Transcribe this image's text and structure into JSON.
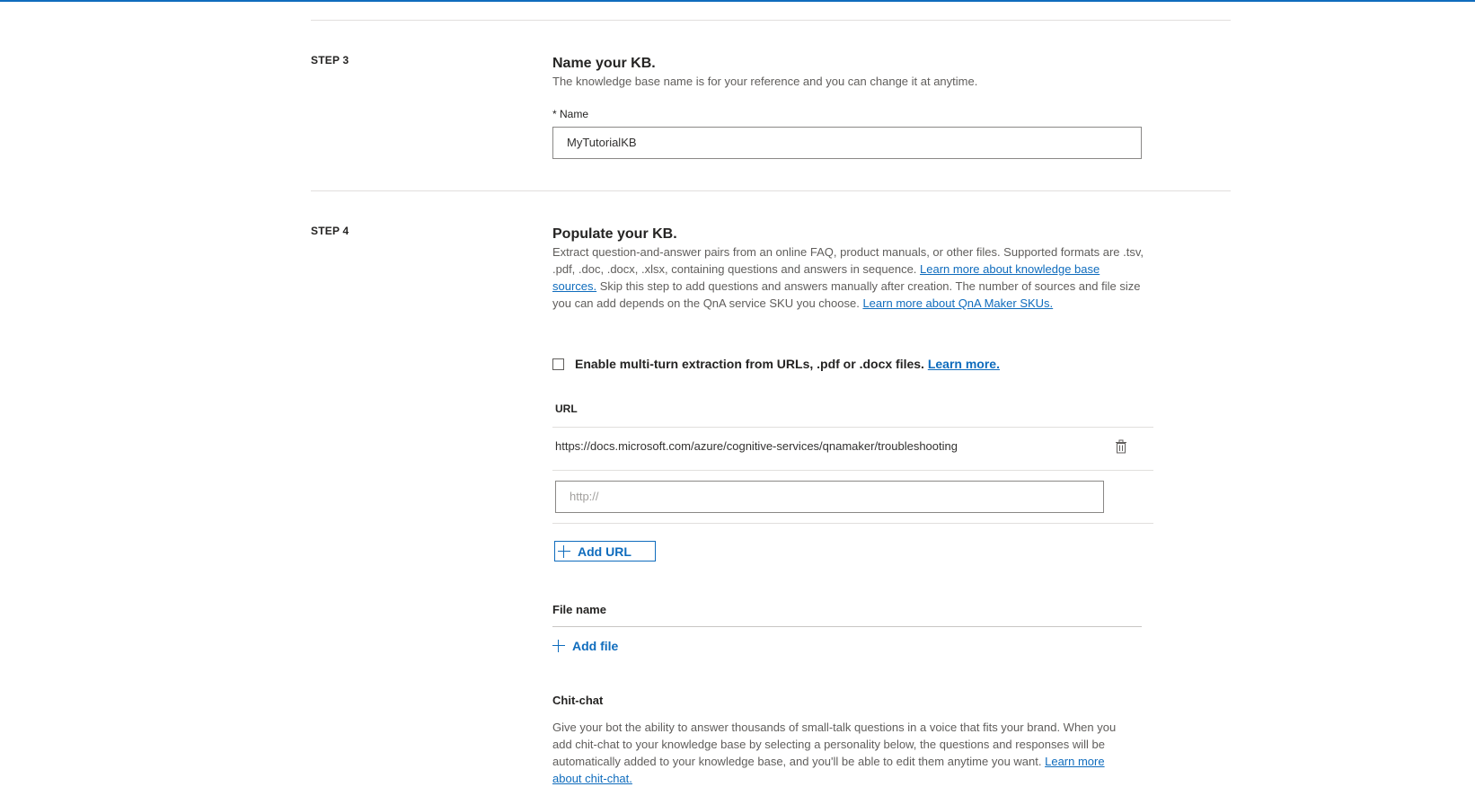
{
  "step3": {
    "label": "STEP 3",
    "title": "Name your KB.",
    "description": "The knowledge base name is for your reference and you can change it at anytime.",
    "name_label": "* Name",
    "name_value": "MyTutorialKB"
  },
  "step4": {
    "label": "STEP 4",
    "title": "Populate your KB.",
    "description_part1": "Extract question-and-answer pairs from an online FAQ, product manuals, or other files. Supported formats are .tsv, .pdf, .doc, .docx, .xlsx, containing questions and answers in sequence. ",
    "link_sources": "Learn more about knowledge base sources.",
    "description_part2": " Skip this step to add questions and answers manually after creation. The number of sources and file size you can add depends on the QnA service SKU you choose. ",
    "link_skus": "Learn more about QnA Maker SKUs.",
    "multiturn_label": "Enable multi-turn extraction from URLs, .pdf or .docx files.",
    "multiturn_link": "Learn more.",
    "multiturn_checked": false,
    "url_header": "URL",
    "urls": [
      "https://docs.microsoft.com/azure/cognitive-services/qnamaker/troubleshooting"
    ],
    "url_placeholder": "http://",
    "add_url_label": "Add URL",
    "file_header": "File name",
    "add_file_label": "Add file",
    "chitchat_title": "Chit-chat",
    "chitchat_description": "Give your bot the ability to answer thousands of small-talk questions in a voice that fits your brand. When you add chit-chat to your knowledge base by selecting a personality below, the questions and responses will be automatically added to your knowledge base, and you'll be able to edit them anytime you want. ",
    "chitchat_link": "Learn more about chit-chat."
  },
  "colors": {
    "accent": "#0f6cbd",
    "text": "#252423",
    "muted": "#605e5c"
  },
  "icons": {
    "delete": "trash-icon",
    "add": "plus-icon"
  }
}
